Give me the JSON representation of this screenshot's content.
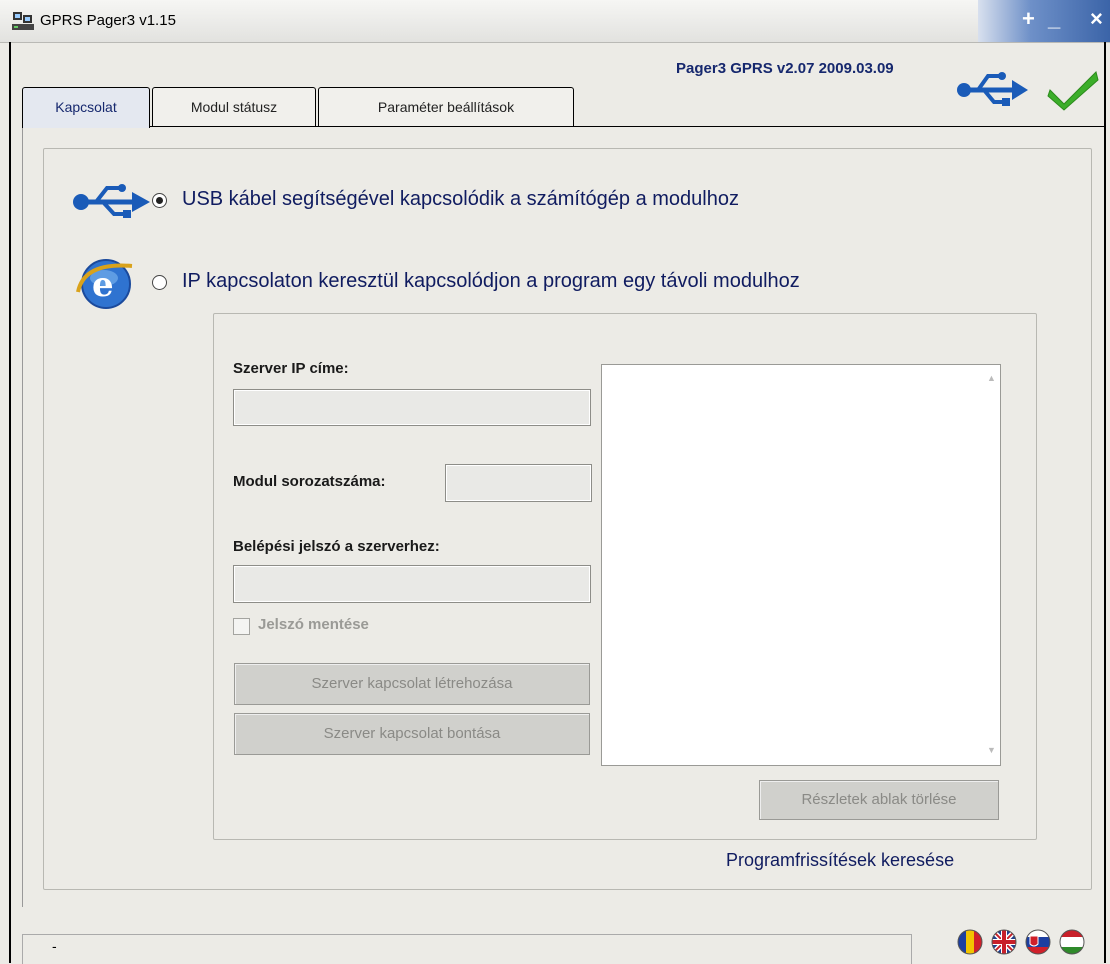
{
  "window": {
    "title": "GPRS Pager3 v1.15",
    "version": "Pager3 GPRS v2.07 2009.03.09"
  },
  "tabs": [
    {
      "label": "Kapcsolat"
    },
    {
      "label": "Modul státusz"
    },
    {
      "label": "Paraméter beállítások"
    }
  ],
  "connection": {
    "usb_label": "USB kábel segítségével kapcsolódik a számítógép a modulhoz",
    "ip_label": "IP kapcsolaton keresztül kapcsolódjon a program egy távoli modulhoz",
    "selected": "usb"
  },
  "server": {
    "ip_label": "Szerver IP címe:",
    "ip_value": "",
    "serial_label": "Modul sorozatszáma:",
    "serial_value": "",
    "password_label": "Belépési jelszó a szerverhez:",
    "password_value": "",
    "save_password_label": "Jelszó mentése",
    "connect_button": "Szerver kapcsolat létrehozása",
    "disconnect_button": "Szerver kapcsolat bontása",
    "clear_details_button": "Részletek ablak törlése"
  },
  "update_link": "Programfrissítések keresése",
  "status_text": "-",
  "icons": {
    "app": "app-icon",
    "usb": "usb-icon",
    "ok": "checkmark-icon",
    "ie": "internet-explorer-icon",
    "flags": [
      "romania-flag-icon",
      "uk-flag-icon",
      "slovakia-flag-icon",
      "hungary-flag-icon"
    ]
  },
  "colors": {
    "accent_text": "#101c60",
    "check_green": "#3cae2a",
    "usb_blue": "#1a5bb8"
  }
}
